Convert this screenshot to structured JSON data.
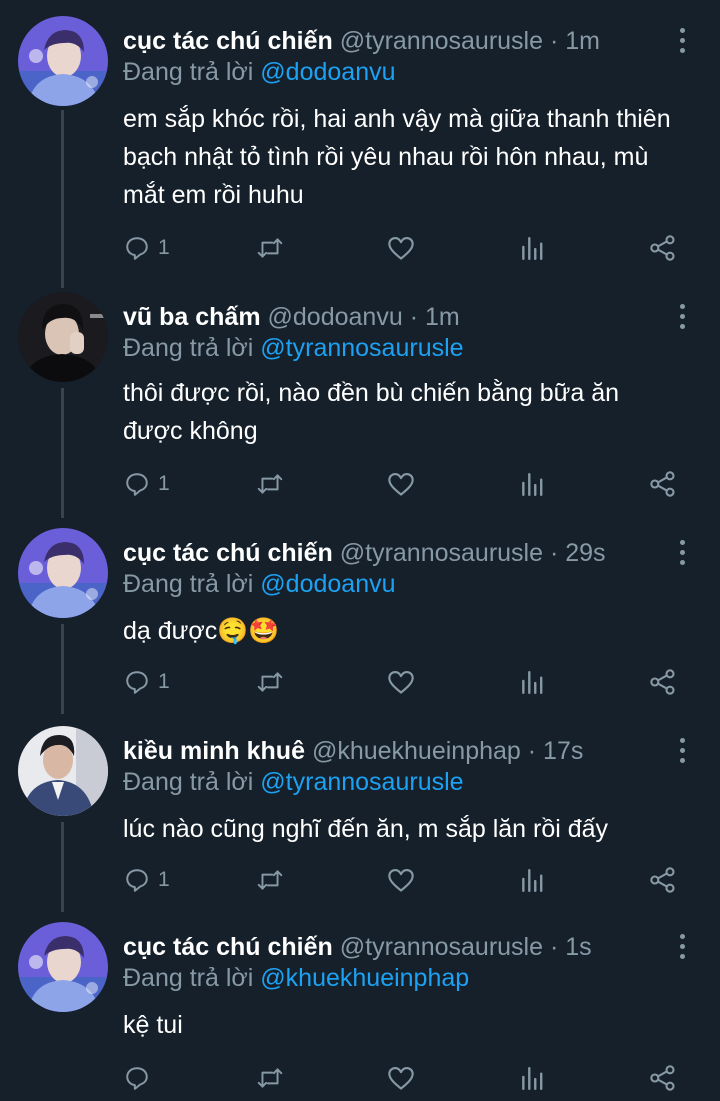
{
  "colors": {
    "background": "#15202b",
    "thread_line": "#38444d",
    "muted": "#8899a6",
    "link": "#1da1f2",
    "text": "#ffffff"
  },
  "tweets": [
    {
      "name": "cục tác chú chiến",
      "handle": "@tyrannosaurusle",
      "sep": "·",
      "time": "1m",
      "reply_prefix": "Đang trả lời",
      "reply_to": "@dodoanvu",
      "text": "em sắp khóc rồi, hai anh vậy mà giữa thanh thiên bạch nhật tỏ tình rồi yêu nhau rồi hôn nhau, mù mắt em rồi huhu",
      "reply_count": "1",
      "avatar_icon": "purple-avatar-icon"
    },
    {
      "name": "vũ ba chấm",
      "handle": "@dodoanvu",
      "sep": "·",
      "time": "1m",
      "reply_prefix": "Đang trả lời",
      "reply_to": "@tyrannosaurusle",
      "text": "thôi được rồi, nào đền bù chiến bằng bữa ăn được không",
      "reply_count": "1",
      "avatar_icon": "dark-avatar-icon"
    },
    {
      "name": "cục tác chú chiến",
      "handle": "@tyrannosaurusle",
      "sep": "·",
      "time": "29s",
      "reply_prefix": "Đang trả lời",
      "reply_to": "@dodoanvu",
      "text": "dạ được🤤🤩",
      "reply_count": "1",
      "avatar_icon": "purple-avatar-icon"
    },
    {
      "name": "kiều minh khuê",
      "handle": "@khuekhueinphap",
      "sep": "·",
      "time": "17s",
      "reply_prefix": "Đang trả lời",
      "reply_to": "@tyrannosaurusle",
      "text": "lúc nào cũng nghĩ đến ăn, m sắp lăn rồi đấy",
      "reply_count": "1",
      "avatar_icon": "light-avatar-icon"
    },
    {
      "name": "cục tác chú chiến",
      "handle": "@tyrannosaurusle",
      "sep": "·",
      "time": "1s",
      "reply_prefix": "Đang trả lời",
      "reply_to": "@khuekhueinphap",
      "text": "kệ tui",
      "reply_count": "",
      "avatar_icon": "purple-avatar-icon"
    }
  ]
}
